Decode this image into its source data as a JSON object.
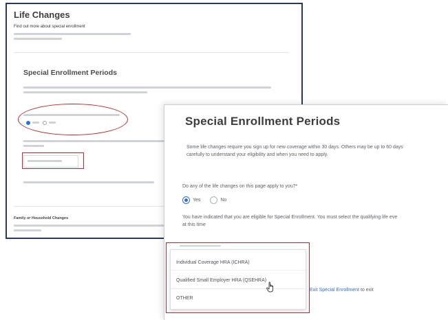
{
  "back_panel": {
    "title": "Life Changes",
    "subtitle": "Find out more about special enrollment",
    "heading": "Special Enrollment Periods",
    "family_heading": "Family or Household Changes"
  },
  "front_panel": {
    "heading": "Special Enrollment Periods",
    "description_line1": "Some life changes require you sign up for new coverage within 30 days. Others may be up to 60 days",
    "description_line2": "carefully to understand your eligibility and when you need to apply.",
    "question": "Do any of the life changes on this page apply to you?*",
    "radio_yes": "Yes",
    "radio_no": "No",
    "selected_option": "Yes",
    "eligibility_line1": "You have indicated that you are eligible for Special Enrollment. You must select the qualifying life eve",
    "eligibility_line2": "at this time",
    "menu_options": [
      "Individual Coverage HRA (ICHRA)",
      "Qualified Small Employer HRA (QSEHRA)",
      "OTHER"
    ],
    "exit_link": "Exit Special Enrollment",
    "exit_suffix": "to exit"
  },
  "colors": {
    "accent_blue": "#2f6fd6",
    "annotation_red": "#c0262d",
    "back_border": "#23395d"
  },
  "icons": [
    "radio-selected-icon",
    "radio-unselected-icon",
    "hand-pointer-icon"
  ]
}
